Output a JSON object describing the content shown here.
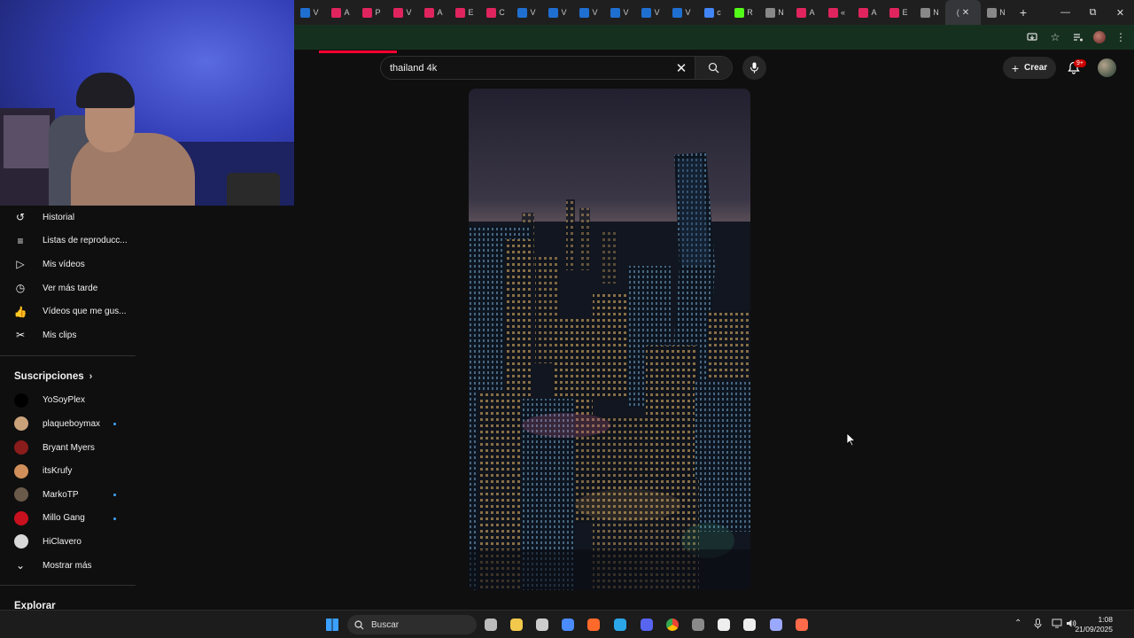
{
  "browser": {
    "tabs": [
      {
        "icon": "outlook-icon",
        "color": "#1f6fd1",
        "letter": "V"
      },
      {
        "icon": "airbnb-icon",
        "color": "#e0245e",
        "letter": "A"
      },
      {
        "icon": "airbnb-icon",
        "color": "#e0245e",
        "letter": "P"
      },
      {
        "icon": "airbnb-icon",
        "color": "#e0245e",
        "letter": "V"
      },
      {
        "icon": "airbnb-icon",
        "color": "#e0245e",
        "letter": "A"
      },
      {
        "icon": "airbnb-icon",
        "color": "#e0245e",
        "letter": "E"
      },
      {
        "icon": "airbnb-icon",
        "color": "#e0245e",
        "letter": "C"
      },
      {
        "icon": "outlook-icon",
        "color": "#1f6fd1",
        "letter": "V"
      },
      {
        "icon": "outlook-icon",
        "color": "#1f6fd1",
        "letter": "V"
      },
      {
        "icon": "outlook-icon",
        "color": "#1f6fd1",
        "letter": "V"
      },
      {
        "icon": "outlook-icon",
        "color": "#1f6fd1",
        "letter": "V"
      },
      {
        "icon": "outlook-icon",
        "color": "#1f6fd1",
        "letter": "V"
      },
      {
        "icon": "outlook-icon",
        "color": "#1f6fd1",
        "letter": "V"
      },
      {
        "icon": "google-icon",
        "color": "#4285f4",
        "letter": "c"
      },
      {
        "icon": "kick-icon",
        "color": "#53fc18",
        "letter": "R"
      },
      {
        "icon": "chrome-icon",
        "color": "#888888",
        "letter": "N"
      },
      {
        "icon": "airbnb-icon",
        "color": "#e0245e",
        "letter": "A"
      },
      {
        "icon": "airbnb-icon",
        "color": "#e0245e",
        "letter": "«"
      },
      {
        "icon": "airbnb-icon",
        "color": "#e0245e",
        "letter": "A"
      },
      {
        "icon": "airbnb-icon",
        "color": "#e0245e",
        "letter": "E"
      },
      {
        "icon": "chrome-icon",
        "color": "#888888",
        "letter": "N"
      }
    ],
    "active_tab_letter": "(",
    "close_label": "✕",
    "next_tab": {
      "icon": "chrome-icon",
      "letter": "N"
    },
    "newtab_label": "+",
    "window": {
      "minimize": "—",
      "restore": "⧉",
      "close": "✕"
    }
  },
  "youtube": {
    "search": {
      "value": "thailand 4k"
    },
    "create_label": "Crear",
    "notifications_badge": "9+",
    "sidebar": {
      "items": [
        {
          "icon": "history-icon",
          "glyph": "↺",
          "label": "Historial"
        },
        {
          "icon": "playlist-icon",
          "glyph": "≡",
          "label": "Listas de reproducc..."
        },
        {
          "icon": "my-videos-icon",
          "glyph": "▷",
          "label": "Mis vídeos"
        },
        {
          "icon": "watch-later-icon",
          "glyph": "◷",
          "label": "Ver más tarde"
        },
        {
          "icon": "like-icon",
          "glyph": "👍",
          "label": "Vídeos que me gus..."
        },
        {
          "icon": "clips-icon",
          "glyph": "✂",
          "label": "Mis clips"
        }
      ],
      "subscriptions_title": "Suscripciones",
      "subscriptions": [
        {
          "name": "YoSoyPlex",
          "avatar": "#000000",
          "live": false
        },
        {
          "name": "plaqueboymax",
          "avatar": "#c9a27a",
          "live": true
        },
        {
          "name": "Bryant Myers",
          "avatar": "#8b1c1c",
          "live": false
        },
        {
          "name": "itsKrufy",
          "avatar": "#d08f5a",
          "live": false
        },
        {
          "name": "MarkoTP",
          "avatar": "#6a5a4a",
          "live": true
        },
        {
          "name": "Millo Gang",
          "avatar": "#c8101e",
          "live": true
        },
        {
          "name": "HiClavero",
          "avatar": "#d8d8d8",
          "live": false
        }
      ],
      "show_more": "Mostrar más",
      "explore_title": "Explorar"
    }
  },
  "taskbar": {
    "search_placeholder": "Buscar",
    "time": "1:08",
    "date": "21/09/2025",
    "apps": [
      "windows-start-icon",
      "task-view-icon",
      "file-explorer-icon",
      "chatgpt-icon",
      "microsoft-store-icon",
      "brave-icon",
      "edge-icon",
      "discord-icon",
      "chrome-icon",
      "gamepad-icon",
      "capcut-icon",
      "tiktok-icon",
      "settings-icon",
      "media-player-icon"
    ]
  },
  "colors": {
    "youtube_red": "#ff0033",
    "accent_blue": "#3ea6ff",
    "background": "#0f0f0f"
  }
}
